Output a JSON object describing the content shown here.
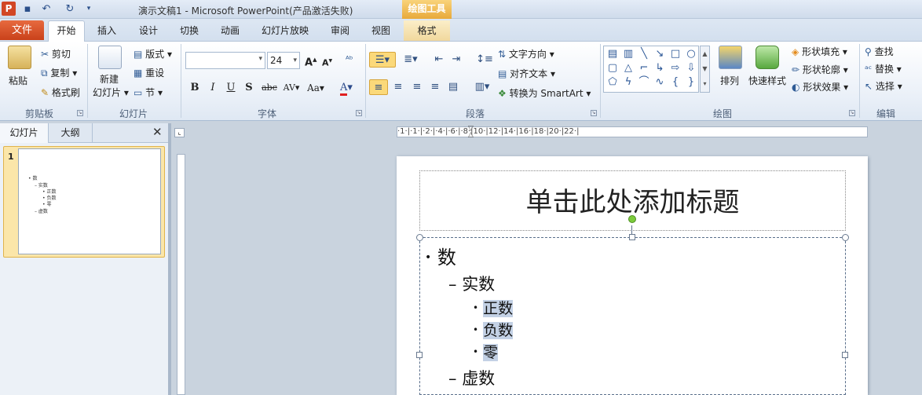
{
  "window": {
    "title": "演示文稿1 - Microsoft PowerPoint(产品激活失败)",
    "context_header": "绘图工具"
  },
  "tabs": {
    "file": "文件",
    "home": "开始",
    "insert": "插入",
    "design": "设计",
    "transitions": "切换",
    "animations": "动画",
    "slideshow": "幻灯片放映",
    "review": "审阅",
    "view": "视图",
    "format": "格式"
  },
  "ribbon": {
    "clipboard": {
      "label": "剪贴板",
      "paste": "粘贴",
      "cut": "剪切",
      "copy": "复制",
      "painter": "格式刷"
    },
    "slides": {
      "label": "幻灯片",
      "new_line1": "新建",
      "new_line2": "幻灯片",
      "layout": "版式",
      "reset": "重设",
      "section": "节"
    },
    "font": {
      "label": "字体",
      "size": "24"
    },
    "paragraph": {
      "label": "段落",
      "text_direction": "文字方向",
      "align_text": "对齐文本",
      "smartart": "转换为 SmartArt"
    },
    "drawing": {
      "label": "绘图",
      "arrange": "排列",
      "quick_styles": "快速样式",
      "fill": "形状填充",
      "outline": "形状轮廓",
      "effects": "形状效果"
    },
    "editing": {
      "label": "编辑",
      "find": "查找",
      "replace": "替换",
      "select": "选择"
    }
  },
  "pane": {
    "tab_slides": "幻灯片",
    "tab_outline": "大纲",
    "slide_number": "1",
    "thumb_lines": [
      "• 数",
      "– 实数",
      "• 正数",
      "• 负数",
      "• 零",
      "– 虚数"
    ]
  },
  "ruler": {
    "top": "·1·|·1·|·2·|·4·|·6·|·8·|10·|12·|14·|16·|18·|20·|22·|"
  },
  "slide": {
    "title_placeholder": "单击此处添加标题",
    "bullets": [
      {
        "level": 1,
        "text": "数"
      },
      {
        "level": 2,
        "text": "实数"
      },
      {
        "level": 3,
        "text": "正数"
      },
      {
        "level": 3,
        "text": "负数"
      },
      {
        "level": 3,
        "text": "零"
      },
      {
        "level": 2,
        "text": "虚数"
      }
    ]
  },
  "colors": {
    "file_tab": "#d24726",
    "context_tab": "#f1d89d",
    "selection": "#c3d1e5"
  }
}
